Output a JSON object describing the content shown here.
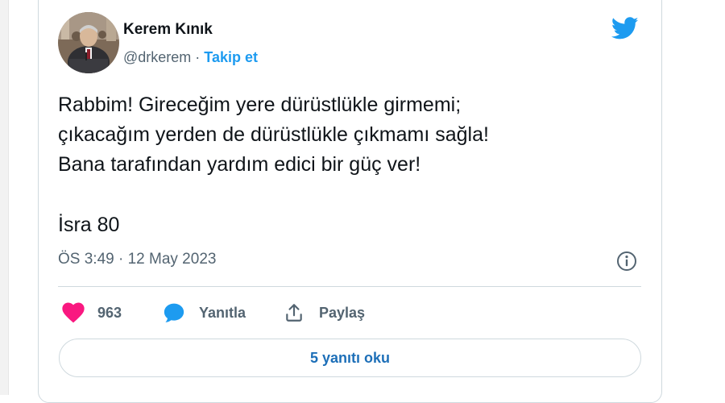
{
  "author": {
    "name": "Kerem Kınık",
    "handle": "@drkerem",
    "separator": " · ",
    "follow_label": "Takip et"
  },
  "tweet": {
    "lines": [
      "Rabbim! Gireceğim yere dürüstlükle girmemi;",
      "çıkacağım yerden de dürüstlükle çıkmamı sağla!",
      "Bana tarafından yardım edici bir güç ver!",
      "İsra 80"
    ],
    "timestamp": "ÖS 3:49 · 12 May 2023"
  },
  "actions": {
    "like_count": "963",
    "reply_label": "Yanıtla",
    "share_label": "Paylaş"
  },
  "read_replies_label": "5 yanıtı oku",
  "icons": {
    "brand": "twitter-bird-icon",
    "info": "info-icon",
    "like": "heart-icon",
    "reply": "speech-bubble-icon",
    "share": "share-icon"
  },
  "colors": {
    "twitter_blue": "#1d9bf0",
    "link_blue": "#1d6fb8",
    "like_pink": "#f91880",
    "text": "#0f1419",
    "muted": "#536471",
    "border": "#cfd9de"
  }
}
